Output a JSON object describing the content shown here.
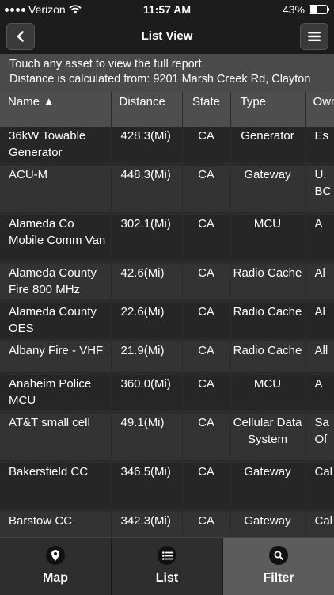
{
  "status_bar": {
    "carrier": "Verizon",
    "time": "11:57 AM",
    "battery": "43%",
    "battery_level": 0.43
  },
  "nav": {
    "title": "List View",
    "back_icon": "chevron-left-icon",
    "menu_icon": "hamburger-menu-icon"
  },
  "info": {
    "line1": "Touch any asset to view the full report.",
    "line2": "Distance is calculated from: 9201 Marsh Creek Rd, Clayton"
  },
  "table": {
    "headers": {
      "name": "Name",
      "name_sort": "▲",
      "distance": "Distance",
      "state": "State",
      "type": "Type",
      "owner": "Own"
    },
    "rows": [
      {
        "name": "36kW Towable Generator",
        "distance": "428.3(Mi)",
        "state": "CA",
        "type": "Generator",
        "owner": "Es"
      },
      {
        "name": "ACU-M",
        "distance": "448.3(Mi)",
        "state": "CA",
        "type": "Gateway",
        "owner": "U.\nBC"
      },
      {
        "name": "Alameda Co Mobile Comm Van",
        "distance": "302.1(Mi)",
        "state": "CA",
        "type": "MCU",
        "owner": "A"
      },
      {
        "name": "Alameda County Fire 800 MHz",
        "distance": "42.6(Mi)",
        "state": "CA",
        "type": "Radio Cache",
        "owner": "Al"
      },
      {
        "name": "Alameda County OES",
        "distance": "22.6(Mi)",
        "state": "CA",
        "type": "Radio Cache",
        "owner": "Al"
      },
      {
        "name": "Albany Fire - VHF",
        "distance": "21.9(Mi)",
        "state": "CA",
        "type": "Radio Cache",
        "owner": "All"
      },
      {
        "name": "Anaheim Police MCU",
        "distance": "360.0(Mi)",
        "state": "CA",
        "type": "MCU",
        "owner": "A"
      },
      {
        "name": "AT&T small cell",
        "distance": "49.1(Mi)",
        "state": "CA",
        "type": "Cellular Data System",
        "owner": "Sa\nOf"
      },
      {
        "name": "Bakersfield CC",
        "distance": "346.5(Mi)",
        "state": "CA",
        "type": "Gateway",
        "owner": "Cal"
      },
      {
        "name": "Barstow CC",
        "distance": "342.3(Mi)",
        "state": "CA",
        "type": "Gateway",
        "owner": "Cal"
      }
    ]
  },
  "tabs": [
    {
      "label": "Map",
      "icon": "map-pin-icon",
      "active": false
    },
    {
      "label": "List",
      "icon": "list-icon",
      "active": false
    },
    {
      "label": "Filter",
      "icon": "search-icon",
      "active": true
    }
  ]
}
